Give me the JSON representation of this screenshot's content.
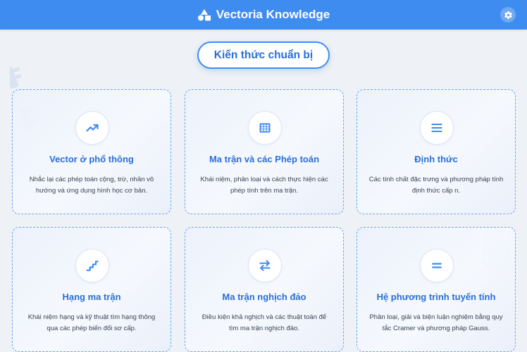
{
  "header": {
    "title": "Vectoria Knowledge",
    "brand_icon": "shapes-icon",
    "settings_icon": "gear-icon"
  },
  "section": {
    "label": "Kiến thức chuẩn bị"
  },
  "colors": {
    "primary": "#3f8cf0",
    "title_text": "#2a6fd6",
    "background": "#eef1f6"
  },
  "cards": [
    {
      "icon": "trending-up-icon",
      "title": "Vector ở phổ thông",
      "description": "Nhắc lại các phép toán cộng, trừ, nhân vô hướng và ứng dụng hình học cơ bản."
    },
    {
      "icon": "grid-icon",
      "title": "Ma trận và các Phép toán",
      "description": "Khái niệm, phân loại và cách thực hiện các phép tính trên ma trận."
    },
    {
      "icon": "lines-icon",
      "title": "Định thức",
      "description": "Các tính chất đặc trưng và phương pháp tính định thức cấp n."
    },
    {
      "icon": "stairs-icon",
      "title": "Hạng ma trận",
      "description": "Khái niệm hạng và kỹ thuật tìm hạng thông qua các phép biến đổi sơ cấp."
    },
    {
      "icon": "swap-arrows-icon",
      "title": "Ma trận nghịch đảo",
      "description": "Điều kiện khả nghịch và các thuật toán để tìm ma trận nghịch đảo."
    },
    {
      "icon": "equals-icon",
      "title": "Hệ phương trình tuyến tính",
      "description": "Phân loại, giải và biện luận nghiệm bằng quy tắc Cramer và phương pháp Gauss."
    }
  ]
}
